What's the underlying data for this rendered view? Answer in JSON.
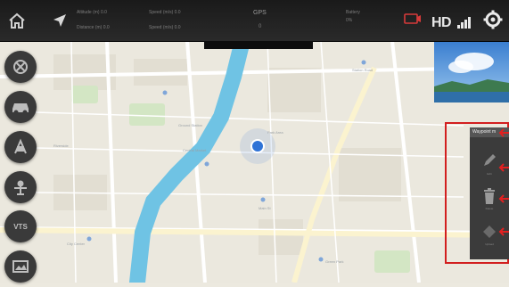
{
  "topbar": {
    "status_items": [
      {
        "label": "Altitude (m)",
        "value": "0.0"
      },
      {
        "label": "Distance (m)",
        "value": "0.0"
      },
      {
        "label": "Speed (m/s)",
        "value": "0.0"
      },
      {
        "label": "Speed (m/s)",
        "value": "0.0"
      }
    ],
    "gps_label": "GPS",
    "gps_value": "0",
    "battery_label": "Battery",
    "battery_value": "0%",
    "video_label": "HD",
    "settings_icon": "gear-icon"
  },
  "map": {
    "place_labels": [
      "Ground Station",
      "Park Area",
      "Central Market",
      "Station Road",
      "Riverside",
      "Main St",
      "Green Park",
      "City Center"
    ]
  },
  "sidebar": {
    "buttons": [
      {
        "name": "takeoff-button",
        "icon": "crosshair-icon"
      },
      {
        "name": "vehicle-button",
        "icon": "car-icon"
      },
      {
        "name": "camera-button",
        "icon": "camera-icon"
      },
      {
        "name": "gimbal-button",
        "icon": "gimbal-icon"
      },
      {
        "name": "mode-button",
        "label": "VTS"
      },
      {
        "name": "gallery-button",
        "icon": "image-icon"
      }
    ]
  },
  "waypoint_panel": {
    "title": "Waypoint m",
    "tools": [
      {
        "icon": "pencil-icon",
        "label": "Edit"
      },
      {
        "icon": "trash-icon",
        "label": "Delete"
      },
      {
        "icon": "diamond-icon",
        "label": "Upload"
      }
    ]
  },
  "colors": {
    "highlight": "#d21f1f",
    "river": "#6fc3e4",
    "location_dot": "#2f73d6",
    "panel": "#3b3b3b"
  }
}
